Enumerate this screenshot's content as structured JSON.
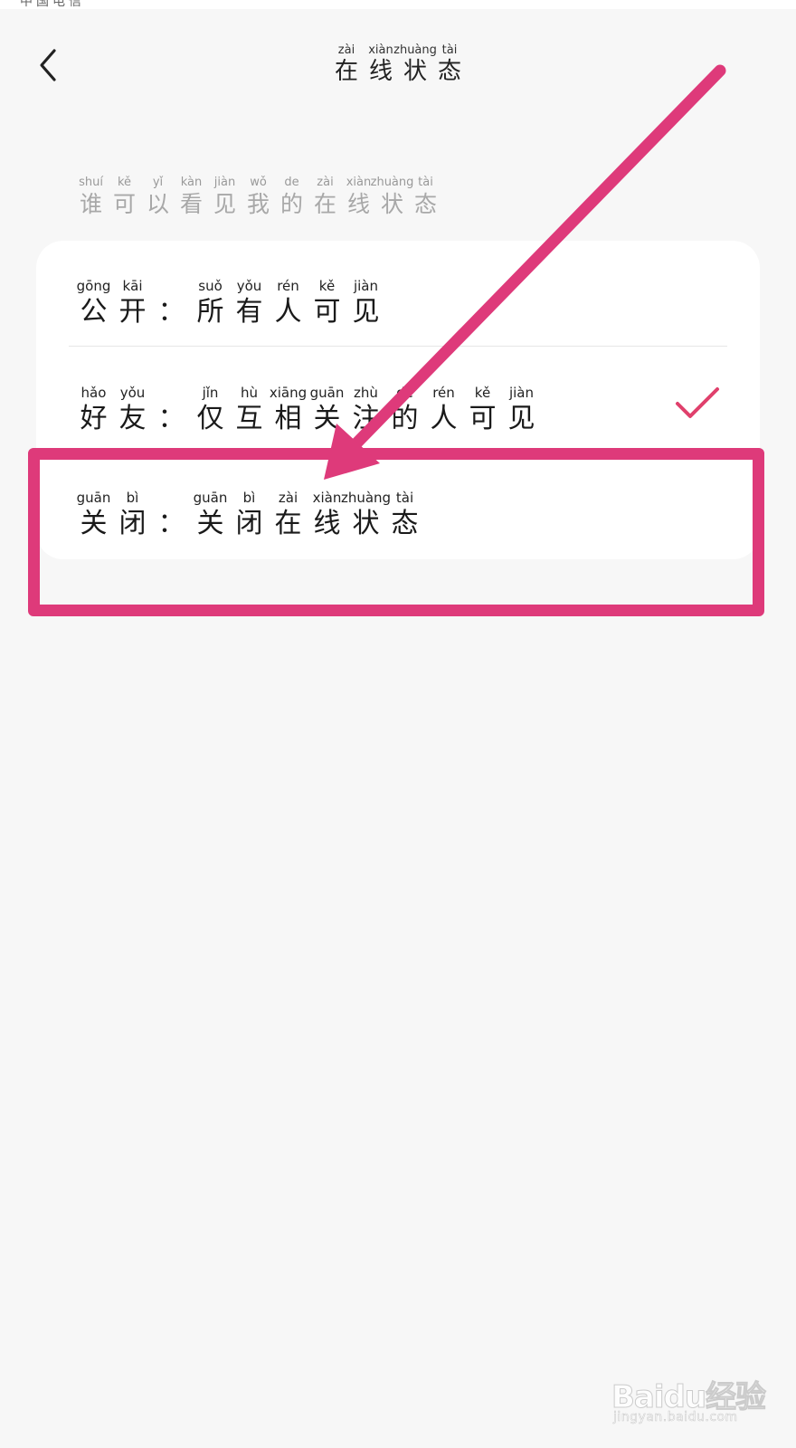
{
  "status_bar": {
    "carrier": "中国电信"
  },
  "header": {
    "title": [
      {
        "hz": "在",
        "py": "zài"
      },
      {
        "hz": "线",
        "py": "xiàn"
      },
      {
        "hz": "状",
        "py": "zhuàng"
      },
      {
        "hz": "态",
        "py": "tài"
      }
    ]
  },
  "section": {
    "label": [
      {
        "hz": "谁",
        "py": "shuí"
      },
      {
        "hz": "可",
        "py": "kě"
      },
      {
        "hz": "以",
        "py": "yǐ"
      },
      {
        "hz": "看",
        "py": "kàn"
      },
      {
        "hz": "见",
        "py": "jiàn"
      },
      {
        "hz": "我",
        "py": "wǒ"
      },
      {
        "hz": "的",
        "py": "de"
      },
      {
        "hz": "在",
        "py": "zài"
      },
      {
        "hz": "线",
        "py": "xiàn"
      },
      {
        "hz": "状",
        "py": "zhuàng"
      },
      {
        "hz": "态",
        "py": "tài"
      }
    ]
  },
  "options": [
    {
      "id": "public",
      "selected": false,
      "label": [
        {
          "hz": "公",
          "py": "gōng"
        },
        {
          "hz": "开",
          "py": "kāi"
        },
        {
          "hz": "：",
          "py": ""
        },
        {
          "hz": "所",
          "py": "suǒ"
        },
        {
          "hz": "有",
          "py": "yǒu"
        },
        {
          "hz": "人",
          "py": "rén"
        },
        {
          "hz": "可",
          "py": "kě"
        },
        {
          "hz": "见",
          "py": "jiàn"
        }
      ]
    },
    {
      "id": "friends",
      "selected": true,
      "label": [
        {
          "hz": "好",
          "py": "hǎo"
        },
        {
          "hz": "友",
          "py": "yǒu"
        },
        {
          "hz": "：",
          "py": ""
        },
        {
          "hz": "仅",
          "py": "jǐn"
        },
        {
          "hz": "互",
          "py": "hù"
        },
        {
          "hz": "相",
          "py": "xiāng"
        },
        {
          "hz": "关",
          "py": "guān"
        },
        {
          "hz": "注",
          "py": "zhù"
        },
        {
          "hz": "的",
          "py": "de"
        },
        {
          "hz": "人",
          "py": "rén"
        },
        {
          "hz": "可",
          "py": "kě"
        },
        {
          "hz": "见",
          "py": "jiàn"
        }
      ]
    },
    {
      "id": "off",
      "selected": false,
      "label": [
        {
          "hz": "关",
          "py": "guān"
        },
        {
          "hz": "闭",
          "py": "bì"
        },
        {
          "hz": "：",
          "py": ""
        },
        {
          "hz": "关",
          "py": "guān"
        },
        {
          "hz": "闭",
          "py": "bì"
        },
        {
          "hz": "在",
          "py": "zài"
        },
        {
          "hz": "线",
          "py": "xiàn"
        },
        {
          "hz": "状",
          "py": "zhuàng"
        },
        {
          "hz": "态",
          "py": "tài"
        }
      ]
    }
  ],
  "colors": {
    "accent": "#e0406c",
    "annotation": "#de3a7a",
    "background": "#f7f7f7",
    "card": "#ffffff"
  },
  "icons": {
    "back": "chevron-left-icon",
    "selected": "checkmark-icon"
  },
  "watermark": {
    "logo": "Baidu经验",
    "url": "jingyan.baidu.com"
  }
}
